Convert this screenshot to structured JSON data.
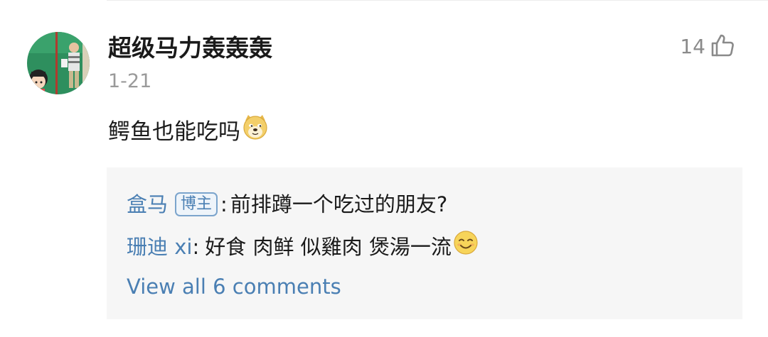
{
  "comment": {
    "username": "超级马力轰轰轰",
    "date": "1-21",
    "like_count": "14",
    "text": "鳄鱼也能吃吗",
    "emoji": "doge-emoji"
  },
  "replies": [
    {
      "author": "盒马",
      "badge": "博主",
      "separator": ":",
      "text": "前排蹲一个吃过的朋友?"
    },
    {
      "author": "珊迪 xi",
      "separator": ":",
      "text": "好食 肉鲜 似雞肉 煲湯一流",
      "emoji": "smile-squint-emoji"
    }
  ],
  "view_all_label": "View all 6 comments",
  "colors": {
    "link": "#4a7fb3",
    "reply_bg": "#f6f6f6",
    "meta": "#9a9a9a"
  }
}
